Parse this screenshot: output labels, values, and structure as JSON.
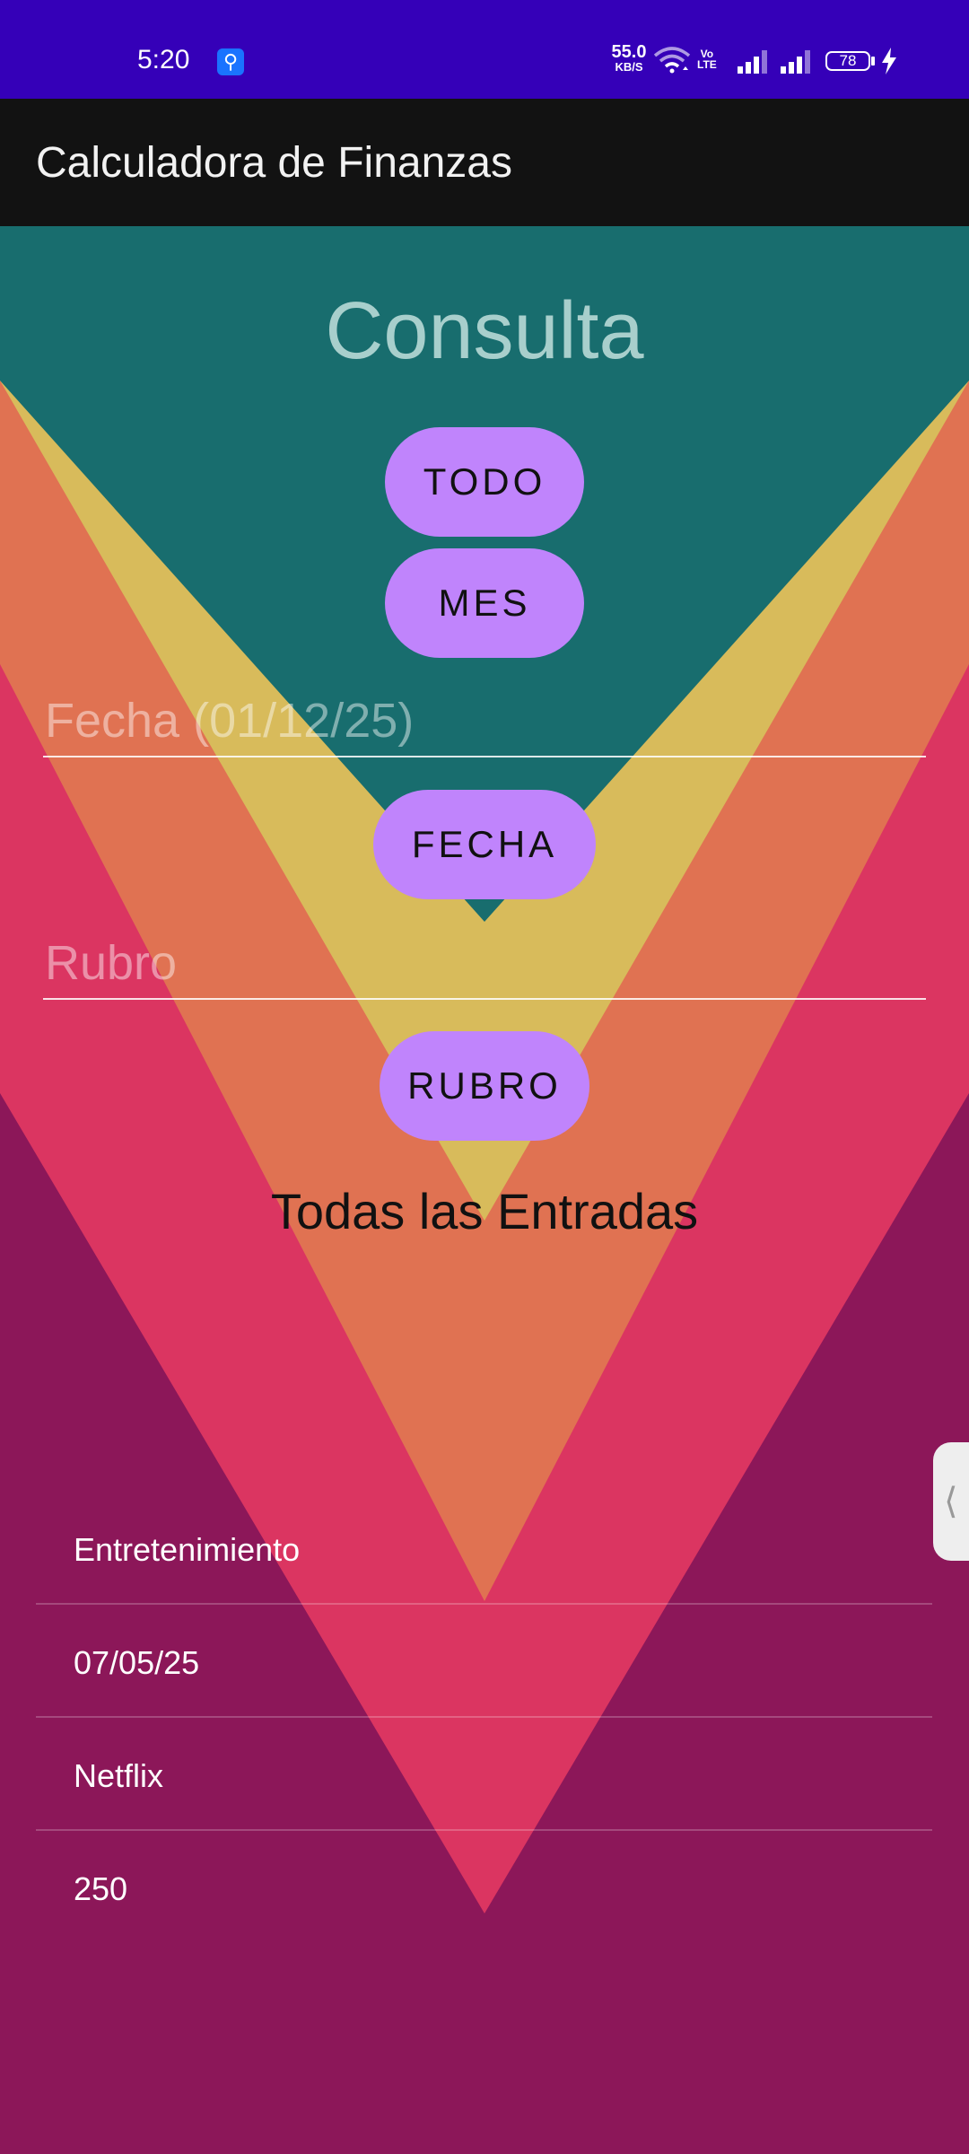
{
  "status_bar": {
    "time": "5:20",
    "net_speed_value": "55.0",
    "net_speed_unit": "KB/S",
    "volte_top": "Vo",
    "volte_bottom": "LTE",
    "battery": "78",
    "icons": [
      "usb-icon",
      "wifi-icon",
      "volte-icon",
      "signal-icon",
      "signal-icon",
      "battery-icon",
      "charging-bolt-icon"
    ]
  },
  "app_bar": {
    "title": "Calculadora de Finanzas"
  },
  "main": {
    "title": "Consulta",
    "buttons": {
      "todo": "TODO",
      "mes": "MES",
      "fecha": "FECHA",
      "rubro": "RUBRO"
    },
    "fecha_field": {
      "placeholder": "Fecha (01/12/25)",
      "value": ""
    },
    "rubro_field": {
      "placeholder": "Rubro",
      "value": ""
    },
    "section_title": "Todas las Entradas",
    "entries": [
      "Entretenimiento",
      "07/05/25",
      "Netflix",
      "250"
    ]
  },
  "edge_handle": {
    "glyph": "⟨"
  },
  "colors": {
    "status_bar": "#3500b8",
    "app_bar": "#121212",
    "teal": "#186d6e",
    "yellow": "#d8bb5b",
    "orange": "#e07252",
    "pink": "#db3561",
    "purple": "#8c1759",
    "button": "#c084fc"
  }
}
